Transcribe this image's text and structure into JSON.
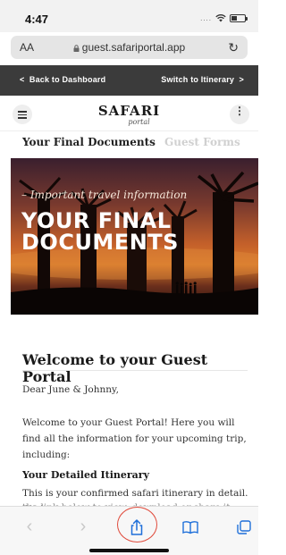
{
  "status": {
    "time": "4:47",
    "signal": "....",
    "icons": [
      "signal-icon",
      "wifi-icon",
      "battery-icon"
    ]
  },
  "browser": {
    "aa_label": "AA",
    "url": "guest.safariportal.app",
    "icons": [
      "lock-icon",
      "reload-icon"
    ]
  },
  "nav": {
    "back": "Back to Dashboard",
    "switch": "Switch to Itinerary",
    "back_arrow": "<",
    "switch_arrow": ">"
  },
  "header": {
    "logo_main": "SAFARI",
    "logo_sub": "portal",
    "more": "⋮",
    "icons": [
      "menu-icon",
      "more-icon"
    ]
  },
  "tabs": {
    "active": "Your Final Documents",
    "inactive": "Guest Forms"
  },
  "hero": {
    "kicker": "– Important travel information",
    "title_line1": "YOUR FINAL",
    "title_line2": "DOCUMENTS"
  },
  "content": {
    "welcome_title": "Welcome to your Guest Portal",
    "greeting": "Dear June & Johnny,",
    "intro": "Welcome to your Guest Portal! Here you will find all the information for your upcoming trip, including:",
    "itinerary_title": "Your Detailed Itinerary",
    "itinerary_text": "This is your confirmed safari itinerary in detail. Click",
    "itinerary_cut": "the link below to view, download or share it"
  },
  "toolbar": {
    "back": "‹",
    "forward": "›",
    "icons": [
      "share-icon",
      "bookmarks-icon",
      "tabs-icon"
    ],
    "highlight_color": "#e04b3c"
  },
  "colors": {
    "nav_bg": "#3b3b3b",
    "address_bg": "#e5e5e5",
    "tab_inactive": "#d0d0d0"
  }
}
